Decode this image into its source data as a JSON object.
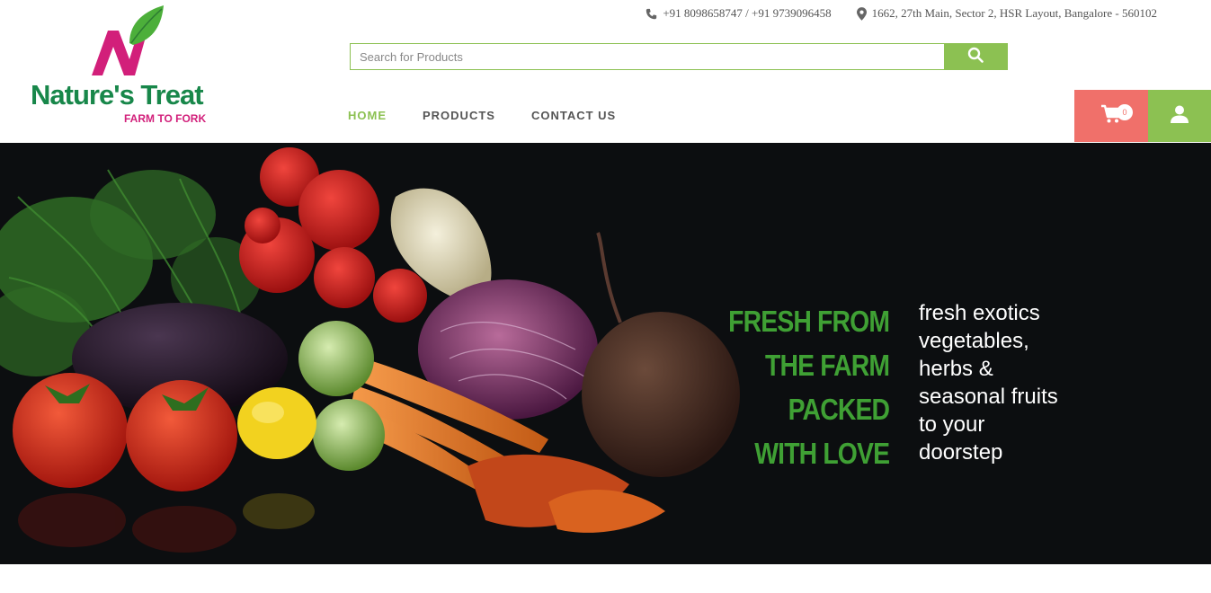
{
  "header": {
    "phone": "+91 8098658747 / +91 9739096458",
    "address": "1662, 27th Main, Sector 2, HSR Layout, Bangalore - 560102",
    "logo_brand": "Nature's Treat",
    "logo_tagline": "FARM TO FORK"
  },
  "search": {
    "placeholder": "Search for Products"
  },
  "nav": {
    "items": [
      {
        "label": "HOME"
      },
      {
        "label": "PRODUCTS"
      },
      {
        "label": "CONTACT US"
      }
    ]
  },
  "cart": {
    "count": "0"
  },
  "hero": {
    "slogan_lines": [
      "FRESH FROM",
      "THE FARM",
      "PACKED",
      "WITH LOVE"
    ],
    "description_lines": [
      "fresh exotics",
      "vegetables,",
      "herbs &",
      "seasonal fruits",
      "to your",
      "doorstep"
    ]
  },
  "icons": {
    "phone": "phone-icon",
    "location": "map-marker-icon",
    "search": "search-icon",
    "cart": "shopping-cart-icon",
    "user": "user-icon"
  },
  "colors": {
    "accent_green": "#8cc152",
    "cart_red": "#f0706a",
    "brand_green": "#18874a",
    "brand_pink": "#d21f7a",
    "slogan_green": "#3fa034"
  }
}
